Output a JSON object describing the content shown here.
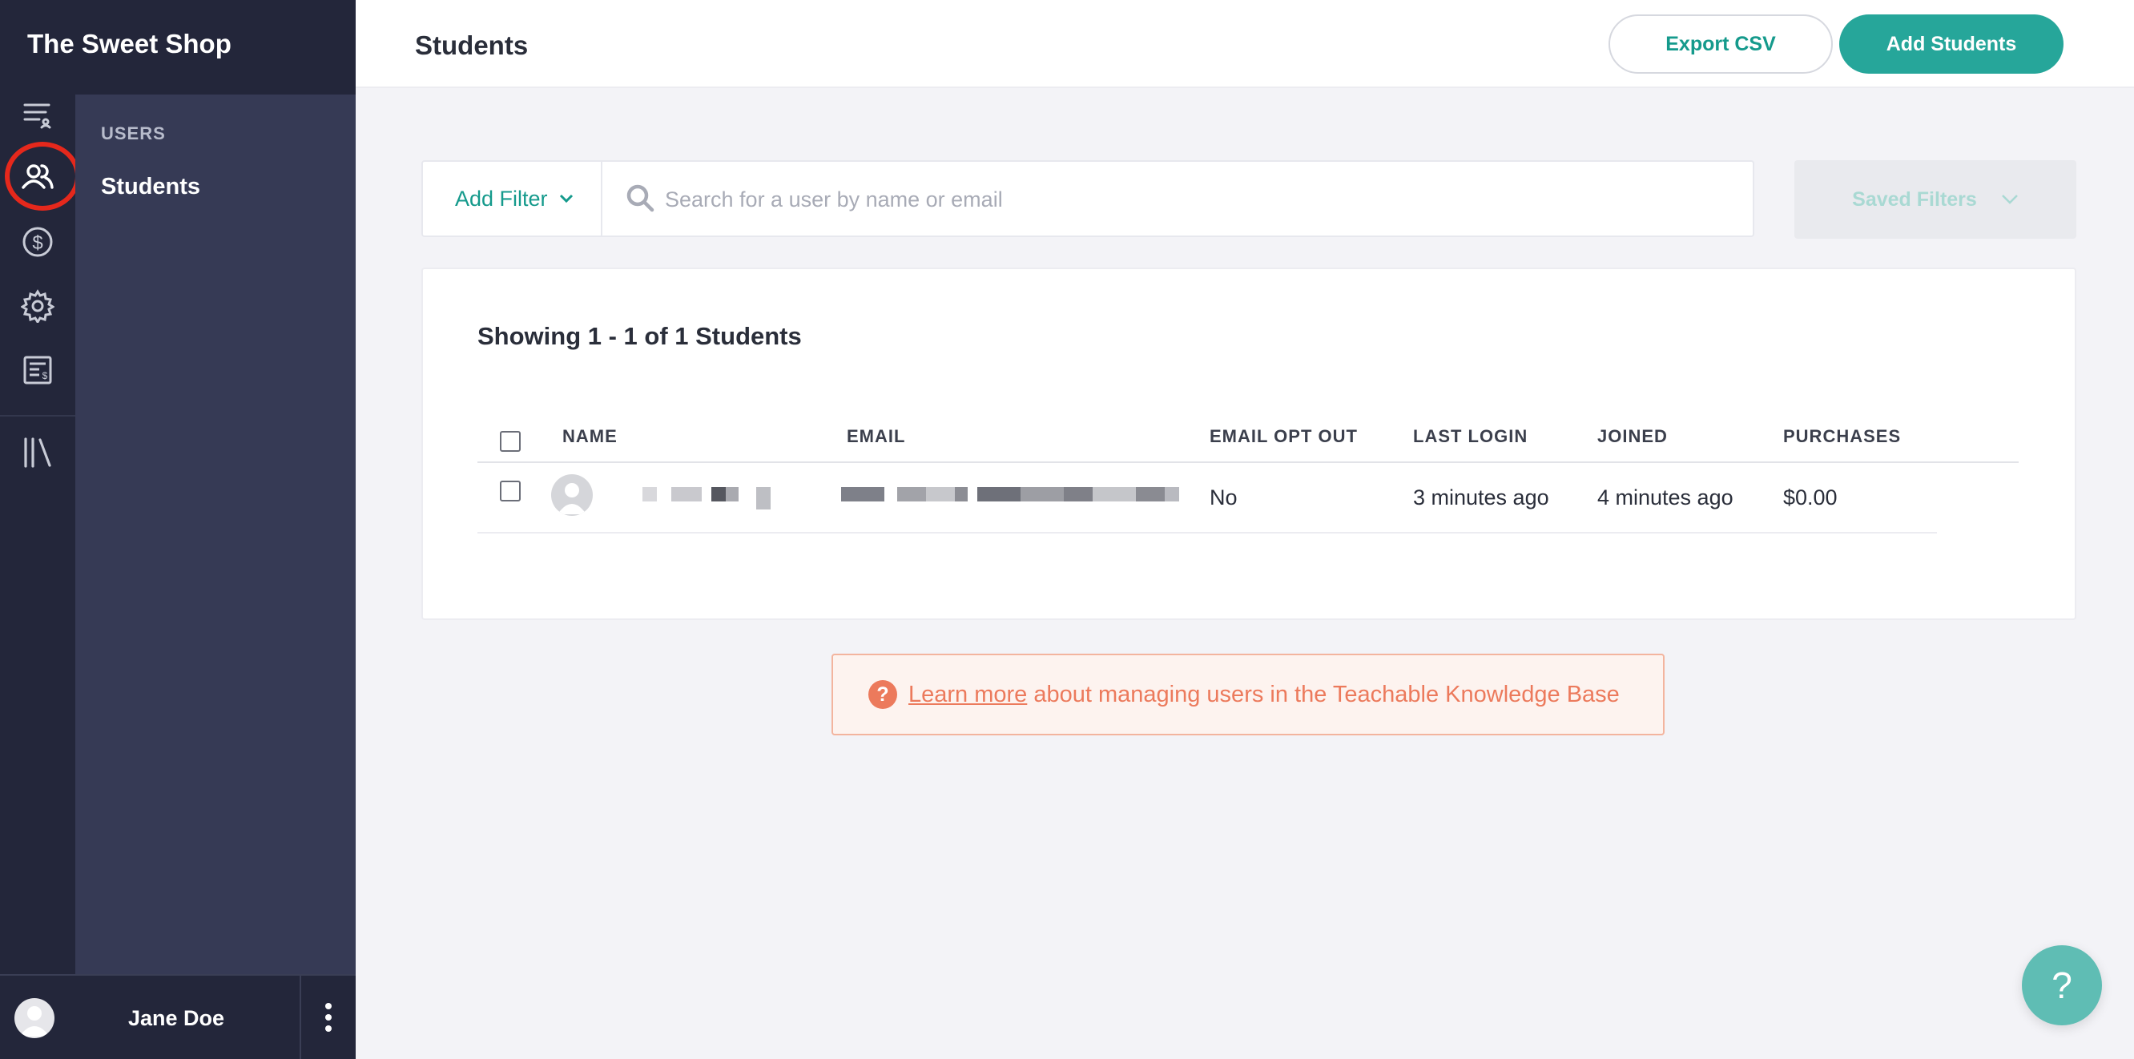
{
  "brand": {
    "name": "The Sweet Shop"
  },
  "rail": {
    "items": [
      {
        "icon": "dashboard-list-icon"
      },
      {
        "icon": "users-icon",
        "active": true
      },
      {
        "icon": "dollar-icon"
      },
      {
        "icon": "gear-icon"
      },
      {
        "icon": "receipt-icon"
      },
      {
        "icon": "library-icon"
      }
    ]
  },
  "subnav": {
    "heading": "USERS",
    "items": [
      {
        "label": "Students"
      }
    ]
  },
  "user": {
    "name": "Jane Doe"
  },
  "header": {
    "title": "Students",
    "export_label": "Export CSV",
    "add_label": "Add Students"
  },
  "filters": {
    "add_filter_label": "Add Filter",
    "search_placeholder": "Search for a user by name or email",
    "saved_filters_label": "Saved Filters"
  },
  "table": {
    "summary": "Showing 1 - 1 of 1 Students",
    "columns": [
      "NAME",
      "EMAIL",
      "EMAIL OPT OUT",
      "LAST LOGIN",
      "JOINED",
      "PURCHASES"
    ],
    "rows": [
      {
        "email_opt_out": "No",
        "last_login": "3 minutes ago",
        "joined": "4 minutes ago",
        "purchases": "$0.00"
      }
    ]
  },
  "notice": {
    "link_text": "Learn more",
    "text": "about managing users in the Teachable Knowledge Base"
  },
  "fab": {
    "label": "?"
  },
  "colors": {
    "accent": "#26a69a",
    "sidebar": "#23263a",
    "subnav": "#363a55",
    "notice": "#ec7a5c"
  }
}
